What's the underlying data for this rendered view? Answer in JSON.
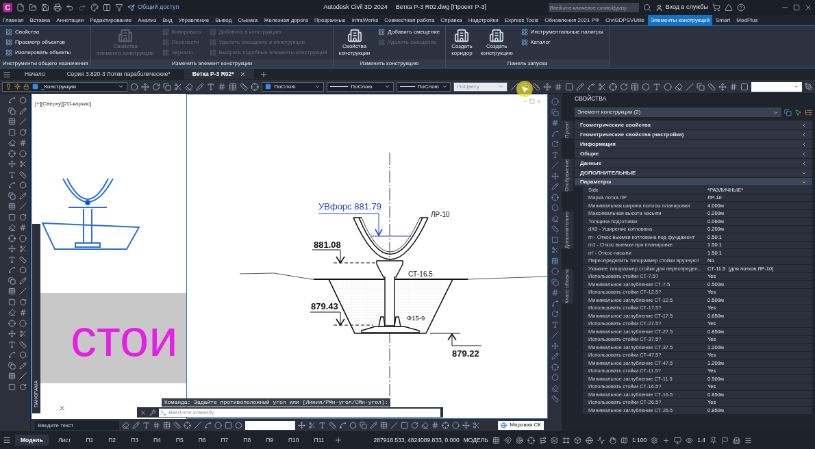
{
  "title_bar": {
    "app_letter": "C",
    "share_label": "Общий доступ",
    "app_title": "Autodesk Civil 3D 2024",
    "file_title": "Ветка Р-3 R02.dwg [Проект Р-3]",
    "search_placeholder": "Введите ключевое слово/фразу",
    "signin_label": "Вход в службы"
  },
  "ribbon_tabs": [
    {
      "label": "Главная",
      "selected": false
    },
    {
      "label": "Вставка",
      "selected": false
    },
    {
      "label": "Аннотации",
      "selected": false
    },
    {
      "label": "Редактирование",
      "selected": false
    },
    {
      "label": "Анализ",
      "selected": false
    },
    {
      "label": "Вид",
      "selected": false
    },
    {
      "label": "Управление",
      "selected": false
    },
    {
      "label": "Вывод",
      "selected": false
    },
    {
      "label": "Съемка",
      "selected": false
    },
    {
      "label": "Железная дорога",
      "selected": false
    },
    {
      "label": "Прозрачные",
      "selected": false
    },
    {
      "label": "InfraWorks",
      "selected": false
    },
    {
      "label": "Совместная работа",
      "selected": false
    },
    {
      "label": "Справка",
      "selected": false
    },
    {
      "label": "Надстройки",
      "selected": false
    },
    {
      "label": "Express Tools",
      "selected": false
    },
    {
      "label": "Обновления 2021 РФ",
      "selected": false
    },
    {
      "label": "Civil3DPSVUtils",
      "selected": false
    },
    {
      "label": "Элементы конструкций",
      "selected": true
    },
    {
      "label": "Smart",
      "selected": false
    },
    {
      "label": "ModPlus",
      "selected": false
    }
  ],
  "ribbon_panels": [
    {
      "title": "Инструменты общего назначения",
      "items": [
        {
          "kind": "small",
          "label": "Свойства",
          "disabled": false
        },
        {
          "kind": "small",
          "label": "Просмотр объектов",
          "disabled": false
        },
        {
          "kind": "small",
          "label": "Изолировать объекты",
          "disabled": false
        }
      ]
    },
    {
      "title": "Изменить элемент конструкции",
      "items": [
        {
          "kind": "large",
          "lines": [
            "Свойства",
            "элемента конструкции"
          ],
          "disabled": true
        },
        {
          "kind": "small",
          "label": "Копировать",
          "disabled": true
        },
        {
          "kind": "small",
          "label": "Перенести",
          "disabled": true
        },
        {
          "kind": "small",
          "label": "Зеркало",
          "disabled": true
        },
        {
          "kind": "small",
          "label": "Добавить в конструкцию",
          "disabled": true
        },
        {
          "kind": "small",
          "label": "Удалить смещение в конструкции",
          "disabled": true
        },
        {
          "kind": "small",
          "label": "Выбрать подобные элементы конструкций",
          "disabled": true
        }
      ]
    },
    {
      "title": "Изменить конструкцию",
      "items": [
        {
          "kind": "large",
          "lines": [
            "Свойства",
            "конструкции"
          ],
          "disabled": false
        },
        {
          "kind": "small",
          "label": "Добавить смещение",
          "disabled": false
        },
        {
          "kind": "small",
          "label": "Удалить смещение",
          "disabled": true
        }
      ]
    },
    {
      "title": "Панель запуска",
      "items": [
        {
          "kind": "large",
          "lines": [
            "Создать",
            "коридор"
          ],
          "disabled": false
        },
        {
          "kind": "large",
          "lines": [
            "Создать",
            "конструкцию"
          ],
          "disabled": false
        },
        {
          "kind": "small",
          "label": "Инструментальные палитры",
          "disabled": false
        },
        {
          "kind": "small",
          "label": "Каталог",
          "disabled": false
        }
      ]
    }
  ],
  "doc_tabs": [
    {
      "label": "Начало",
      "selected": false
    },
    {
      "label": "Серия 3.820-3 Лотки параболические*",
      "selected": false
    },
    {
      "label": "Ветка Р-3 R02*",
      "selected": true
    }
  ],
  "toolbar": {
    "layer": "_Конструкции",
    "color_style": "ПоСлою",
    "linetype": "ПоСлою",
    "lineweight": "ПоСлою",
    "plot_style": "ПоЦвету"
  },
  "left_viewport": {
    "label": "[+][Сверху][2D-каркас]",
    "text": "стои",
    "panorama": "ПАНОРАМА"
  },
  "drawing": {
    "design_level": "УВфорс 881.79",
    "tray": "ЛР-10",
    "stand": "СТ-16.5",
    "base": "Ф15-9",
    "elevations": [
      "881.08",
      "879.43",
      "879.22"
    ]
  },
  "command": {
    "prompt": "Команда: Задайте противоположный угол или [Линия/РМн-угол/СМн-угол]:",
    "input_placeholder": "Введите команду"
  },
  "bottom_toolbar": {
    "text_placeholder": "Введите текст",
    "ucs": "Мировая СК"
  },
  "properties": {
    "title": "СВОЙСТВА",
    "selection": "Элемент конструкции (2)",
    "side_tabs": [
      "Проект",
      "Отображение",
      "Дополнительно",
      "Класс объекта"
    ],
    "categories": [
      {
        "label": "Геометрические свойства",
        "expanded": false
      },
      {
        "label": "Геометрические свойства (настройка)",
        "expanded": false
      },
      {
        "label": "Информация",
        "expanded": false
      },
      {
        "label": "Общие",
        "expanded": false
      },
      {
        "label": "Данные",
        "expanded": false
      },
      {
        "label": "ДОПОЛНИТЕЛЬНЫЕ",
        "expanded": true
      }
    ],
    "group": {
      "label": "Параметры",
      "expanded": true
    },
    "rows": [
      {
        "name": "Side",
        "value": "*РАЗЛИЧНЫЕ*"
      },
      {
        "name": "Марка лотка ЛР",
        "value": "ЛР-10"
      },
      {
        "name": "Минимальная ширина полосы планировки",
        "value": "4.000м"
      },
      {
        "name": "Максимальная высота насыпи",
        "value": "0.200м"
      },
      {
        "name": "Толщина подготовки",
        "value": "0.060м"
      },
      {
        "name": "dX0 - Уширение котлована",
        "value": "0.200м"
      },
      {
        "name": "m - Откос выемки котлована под фундамент",
        "value": "0.50:1"
      },
      {
        "name": "m1 - Откос выемки при планировке",
        "value": "1.50:1"
      },
      {
        "name": "m' - Откос насыпи",
        "value": "1.50:1"
      },
      {
        "name": "Переопределить типоразмер стойки вручную?",
        "value": "No"
      },
      {
        "name": "Укажите типоразмер стойки для переопредел...",
        "value": "СТ-11.5  (для лотков ЛР-10)"
      },
      {
        "name": "Использовать стойки СТ-7.5?",
        "value": "Yes"
      },
      {
        "name": "Минимальное заглубление СТ-7.5",
        "value": "0.500м"
      },
      {
        "name": "Использовать стойки СТ-12.5?",
        "value": "Yes"
      },
      {
        "name": "Минимальное заглубление СТ-12.5",
        "value": "0.500м"
      },
      {
        "name": "Использовать стойки СТ-17.5?",
        "value": "Yes"
      },
      {
        "name": "Минимальное заглубление СТ-17.5",
        "value": "0.850м"
      },
      {
        "name": "Использовать стойки СТ-27.5?",
        "value": "Yes"
      },
      {
        "name": "Минимальное заглубление СТ-27.5",
        "value": "0.850м"
      },
      {
        "name": "Использовать стойки СТ-37.5?",
        "value": "Yes"
      },
      {
        "name": "Минимальное заглубление СТ-37.5",
        "value": "1.200м"
      },
      {
        "name": "Использовать стойки СТ-47.5?",
        "value": "Yes"
      },
      {
        "name": "Минимальное заглубление СТ-47.5",
        "value": "1.200м"
      },
      {
        "name": "Использовать стойки СТ-11.5?",
        "value": "Yes"
      },
      {
        "name": "Минимальное заглубление СТ-11.5",
        "value": "0.500м"
      },
      {
        "name": "Использовать стойки СТ-16.5?",
        "value": "Yes"
      },
      {
        "name": "Минимальное заглубление СТ-16.5",
        "value": "0.850м"
      },
      {
        "name": "Использовать стойки СТ-26.5?",
        "value": "Yes"
      },
      {
        "name": "Минимальное заглубление СТ-26.5",
        "value": "0.850м"
      }
    ]
  },
  "status_bar": {
    "layout_tabs": [
      {
        "label": "Модель",
        "selected": true
      },
      {
        "label": "Лист",
        "selected": false
      },
      {
        "label": "П1",
        "selected": false
      },
      {
        "label": "П2",
        "selected": false
      },
      {
        "label": "П3",
        "selected": false
      },
      {
        "label": "П4",
        "selected": false
      },
      {
        "label": "П5",
        "selected": false
      },
      {
        "label": "П6",
        "selected": false
      },
      {
        "label": "П7",
        "selected": false
      },
      {
        "label": "П8",
        "selected": false
      },
      {
        "label": "П9",
        "selected": false
      },
      {
        "label": "П10",
        "selected": false
      },
      {
        "label": "П11",
        "selected": false
      }
    ],
    "coordinates": "287918.533, 4824089.833, 0.000",
    "space": "МОДЕЛЬ",
    "scale": "1:100",
    "zoom": "1.4"
  }
}
